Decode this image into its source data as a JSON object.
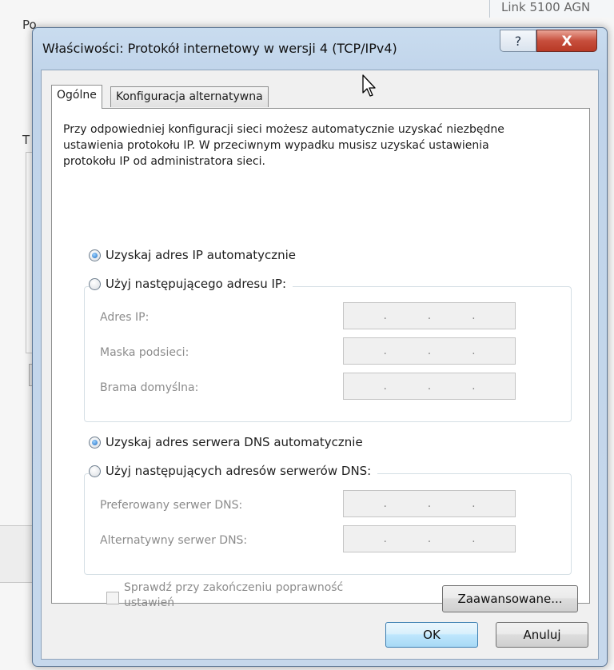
{
  "background": {
    "title_fragment": "Po",
    "top_right_fragment": "Link 5100 AGN",
    "left_letter": "T"
  },
  "dialog": {
    "title": "Właściwości: Protokół internetowy w wersji 4 (TCP/IPv4)",
    "help_label": "?",
    "close_label": "X",
    "tabs": [
      {
        "label": "Ogólne",
        "active": true
      },
      {
        "label": "Konfiguracja alternatywna",
        "active": false
      }
    ],
    "intro_text": "Przy odpowiedniej konfiguracji sieci możesz automatycznie uzyskać niezbędne ustawienia protokołu IP. W przeciwnym wypadku musisz uzyskać ustawienia protokołu IP od administratora sieci.",
    "ip_auto_label": "Uzyskaj adres IP automatycznie",
    "ip_auto_selected": true,
    "ip_manual_label": "Użyj następującego adresu IP:",
    "ip_manual_selected": false,
    "ip_fields": [
      {
        "label": "Adres IP:",
        "value": " .  .  . "
      },
      {
        "label": "Maska podsieci:",
        "value": " .  .  . "
      },
      {
        "label": "Brama domyślna:",
        "value": " .  .  . "
      }
    ],
    "dns_auto_label": "Uzyskaj adres serwera DNS automatycznie",
    "dns_auto_selected": true,
    "dns_manual_label": "Użyj następujących adresów serwerów DNS:",
    "dns_manual_selected": false,
    "dns_fields": [
      {
        "label": "Preferowany serwer DNS:"
      },
      {
        "label": "Alternatywny serwer DNS:"
      }
    ],
    "ip_dots": ".",
    "validate_label_line1": "Sprawdź przy zakończeniu poprawność",
    "validate_label_line2": "ustawień",
    "validate_checked": false,
    "advanced_button": "Zaawansowane...",
    "ok_button": "OK",
    "cancel_button": "Anuluj"
  }
}
